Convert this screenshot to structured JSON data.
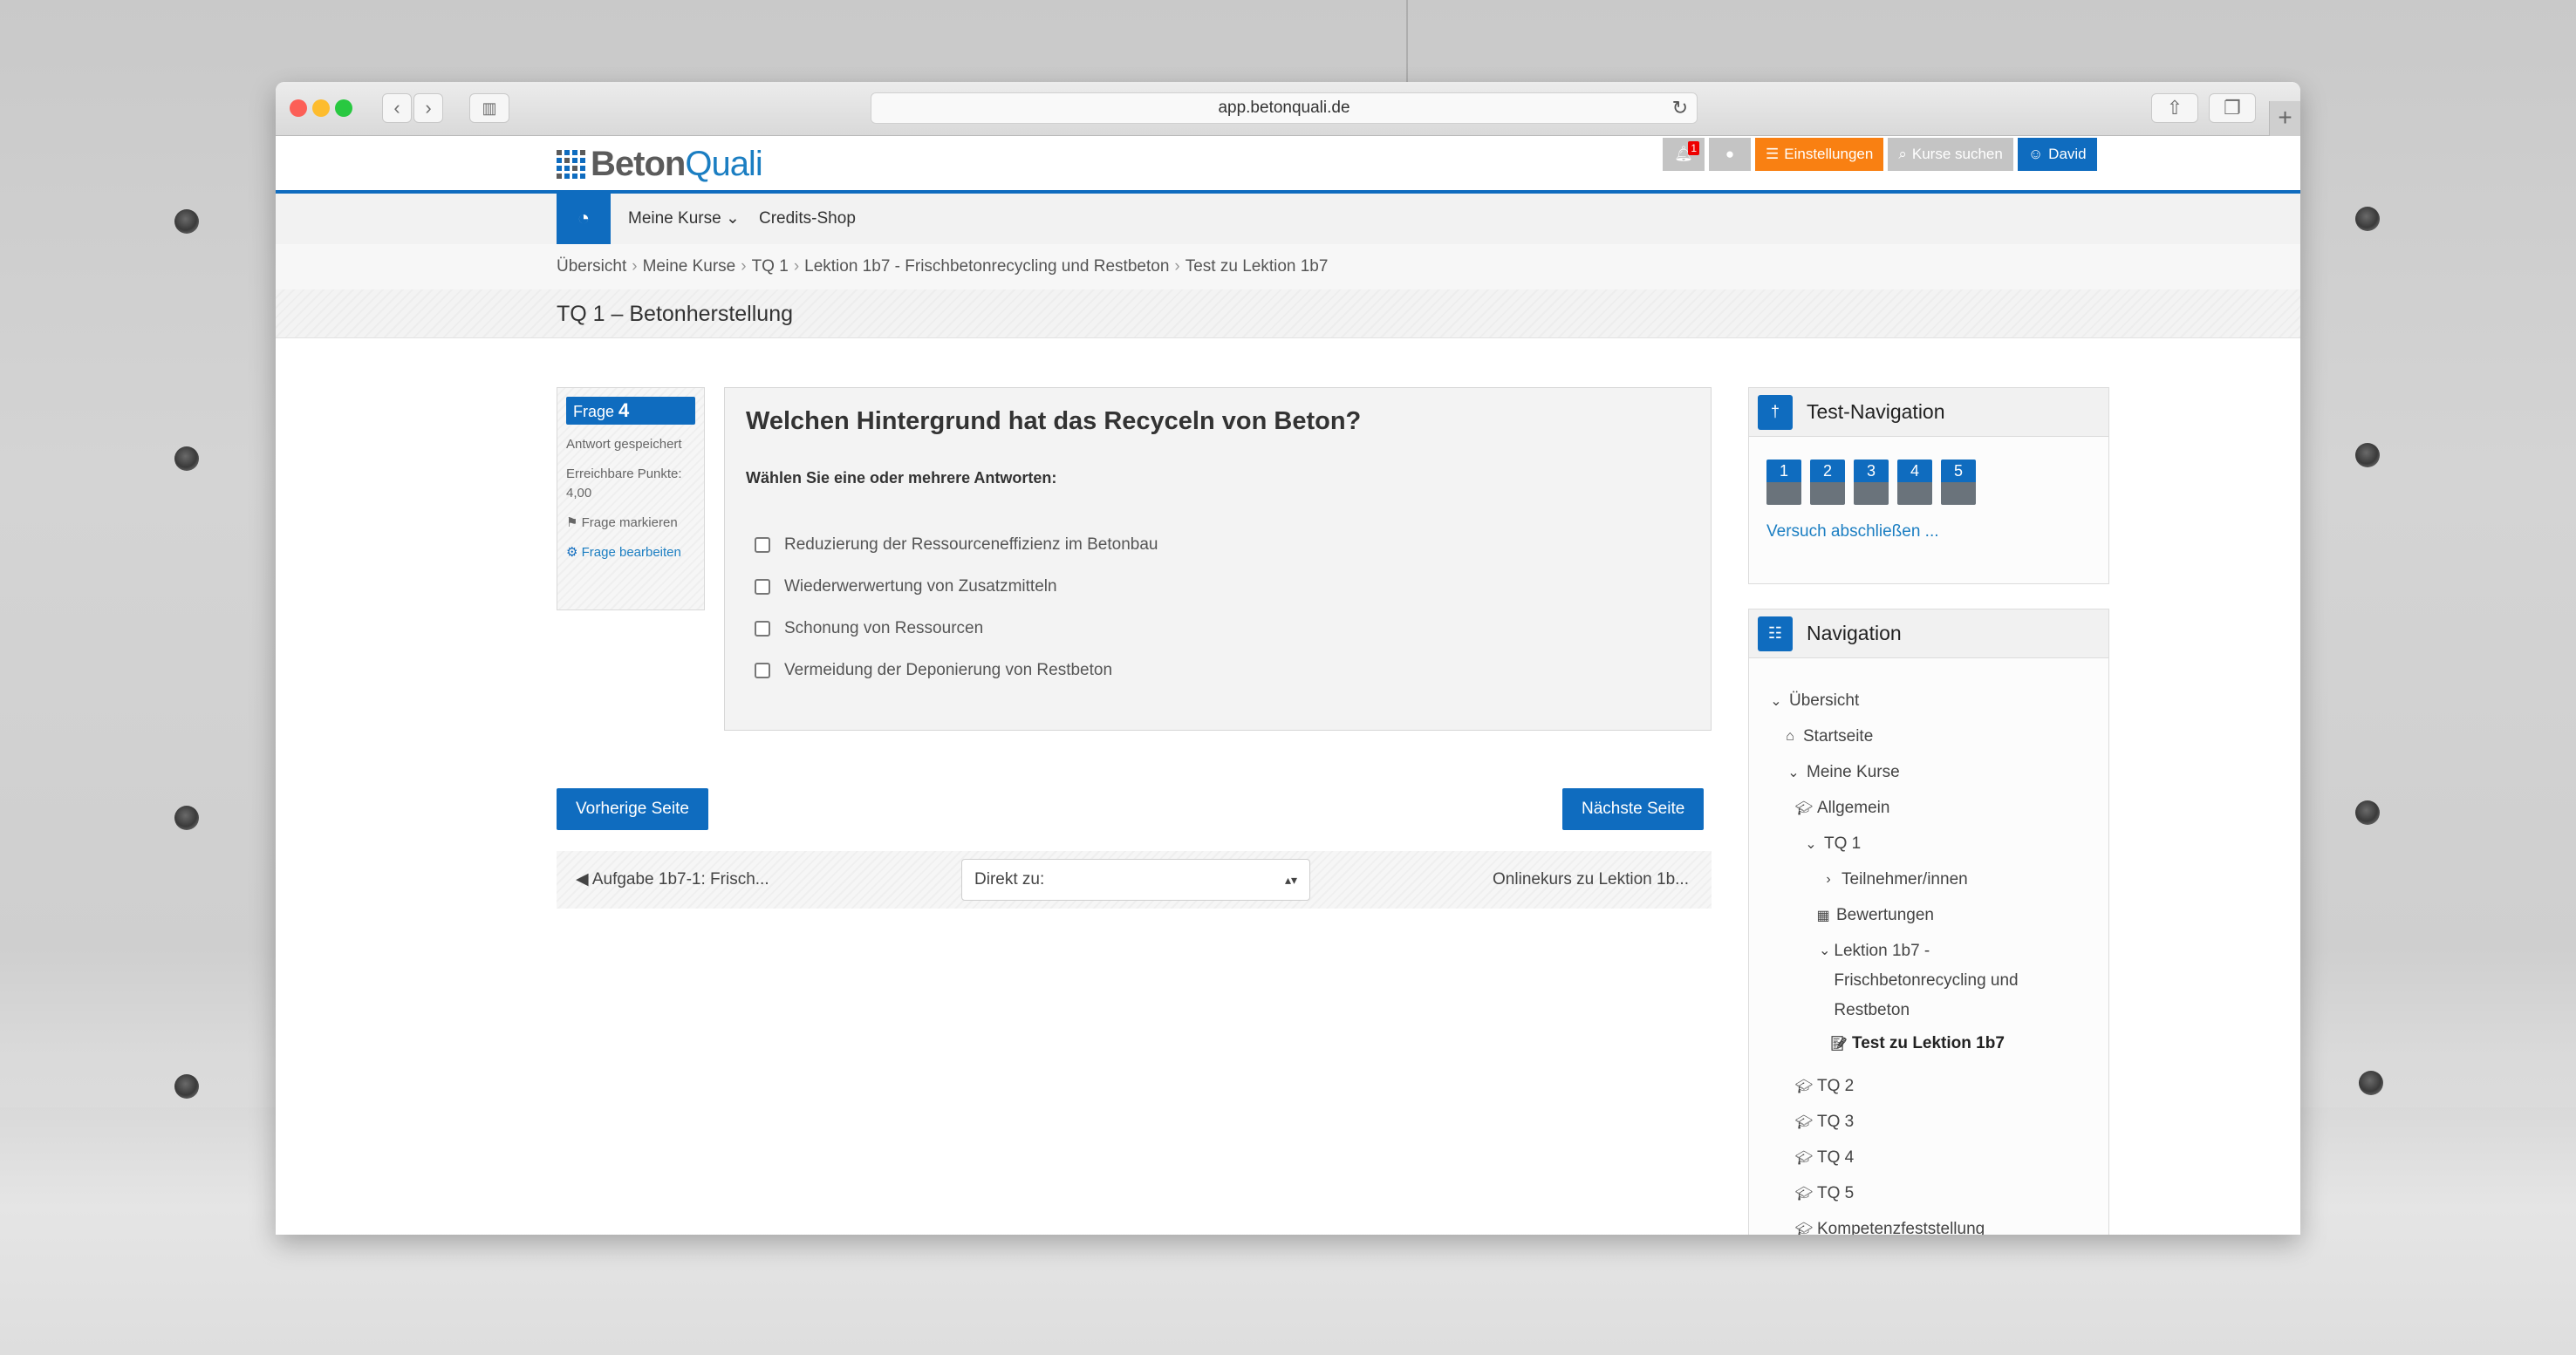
{
  "browser": {
    "url": "app.betonquali.de",
    "new_tab_label": "+"
  },
  "header": {
    "logo_part1": "Beton",
    "logo_part2": "Quali",
    "notifications_count": "1",
    "settings_label": "Einstellungen",
    "search_courses_label": "Kurse suchen",
    "user_label": "David"
  },
  "navbar": {
    "items": [
      {
        "label": "Meine Kurse ⌄"
      },
      {
        "label": "Credits-Shop"
      }
    ]
  },
  "breadcrumb": [
    "Übersicht",
    "Meine Kurse",
    "TQ 1",
    "Lektion 1b7 - Frischbetonrecycling und Restbeton",
    "Test zu Lektion 1b7"
  ],
  "page_title": "TQ 1 – Betonherstellung",
  "question_info": {
    "label": "Frage",
    "number": "4",
    "status": "Antwort gespeichert",
    "points_label": "Erreichbare Punkte:",
    "points_value": "4,00",
    "flag_label": "Frage markieren",
    "edit_label": "Frage bearbeiten"
  },
  "question": {
    "title": "Welchen Hintergrund hat das Recyceln von Beton?",
    "prompt": "Wählen Sie eine oder mehrere Antworten:",
    "answers": [
      {
        "label": "Reduzierung der Ressourceneffizienz im Betonbau",
        "checked": false
      },
      {
        "label": "Wiederwerwertung von Zusatzmitteln",
        "checked": false
      },
      {
        "label": "Schonung von Ressourcen",
        "checked": false
      },
      {
        "label": "Vermeidung der Deponierung von Restbeton",
        "checked": false
      }
    ]
  },
  "pager": {
    "prev_label": "Vorherige Seite",
    "next_label": "Nächste Seite"
  },
  "activity_nav": {
    "prev_label": "◀ Aufgabe 1b7-1: Frisch...",
    "jump_placeholder": "Direkt zu:",
    "next_label": "Onlinekurs zu Lektion 1b..."
  },
  "test_navigation": {
    "title": "Test-Navigation",
    "questions": [
      "1",
      "2",
      "3",
      "4",
      "5"
    ],
    "finish_label": "Versuch abschließen ..."
  },
  "navigation": {
    "title": "Navigation",
    "items": [
      {
        "label": "Übersicht",
        "icon": "chevron-down"
      },
      {
        "label": "Startseite",
        "icon": "home"
      },
      {
        "label": "Meine Kurse",
        "icon": "chevron-down"
      },
      {
        "label": "Allgemein",
        "icon": "graduation-cap"
      },
      {
        "label": "TQ 1",
        "icon": "chevron-down"
      },
      {
        "label": "Teilnehmer/innen",
        "icon": "chevron-right"
      },
      {
        "label": "Bewertungen",
        "icon": "table"
      },
      {
        "label": "Lektion 1b7 - Frischbetonrecycling und Restbeton",
        "icon": "chevron-down"
      },
      {
        "label": "Test zu Lektion 1b7",
        "icon": "quiz"
      },
      {
        "label": "TQ 2",
        "icon": "graduation-cap"
      },
      {
        "label": "TQ 3",
        "icon": "graduation-cap"
      },
      {
        "label": "TQ 4",
        "icon": "graduation-cap"
      },
      {
        "label": "TQ 5",
        "icon": "graduation-cap"
      },
      {
        "label": "Kompetenzfeststellung",
        "icon": "graduation-cap"
      }
    ]
  },
  "colors": {
    "brand_blue": "#0f6cbf",
    "settings_orange": "#f98012",
    "link_blue": "#1b7ec2"
  }
}
